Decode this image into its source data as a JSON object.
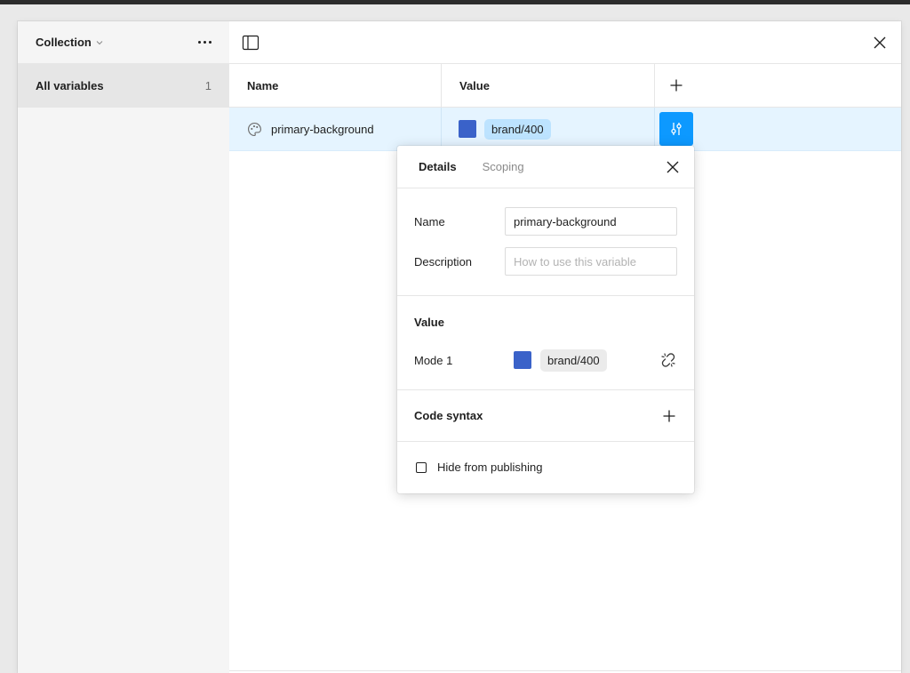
{
  "sidebar": {
    "collection_title": "Collection",
    "items": [
      {
        "label": "All variables",
        "count": "1"
      }
    ]
  },
  "table": {
    "columns": {
      "name": "Name",
      "value": "Value"
    },
    "rows": [
      {
        "name": "primary-background",
        "value_alias": "brand/400",
        "swatch_color": "#3a62c9"
      }
    ]
  },
  "popover": {
    "tabs": [
      {
        "label": "Details",
        "active": true
      },
      {
        "label": "Scoping",
        "active": false
      }
    ],
    "details": {
      "name_label": "Name",
      "name_value": "primary-background",
      "description_label": "Description",
      "description_placeholder": "How to use this variable"
    },
    "value_section": {
      "title": "Value",
      "mode_label": "Mode 1",
      "alias": "brand/400",
      "swatch_color": "#3a62c9"
    },
    "code_syntax": {
      "title": "Code syntax"
    },
    "publishing": {
      "label": "Hide from publishing",
      "checked": false
    }
  },
  "icons": {
    "collection_menu": "chevron-down-icon",
    "more": "more-horizontal-icon",
    "panel": "sidebar-panel-icon",
    "close": "close-icon",
    "add": "plus-icon",
    "row_type": "palette-icon",
    "edit": "adjust-sliders-icon",
    "detach": "detach-link-icon"
  },
  "colors": {
    "accent": "#0d99ff",
    "row_selected": "#e5f4ff",
    "alias_pill_selected": "#bde3ff",
    "alias_pill": "#ebebeb"
  }
}
